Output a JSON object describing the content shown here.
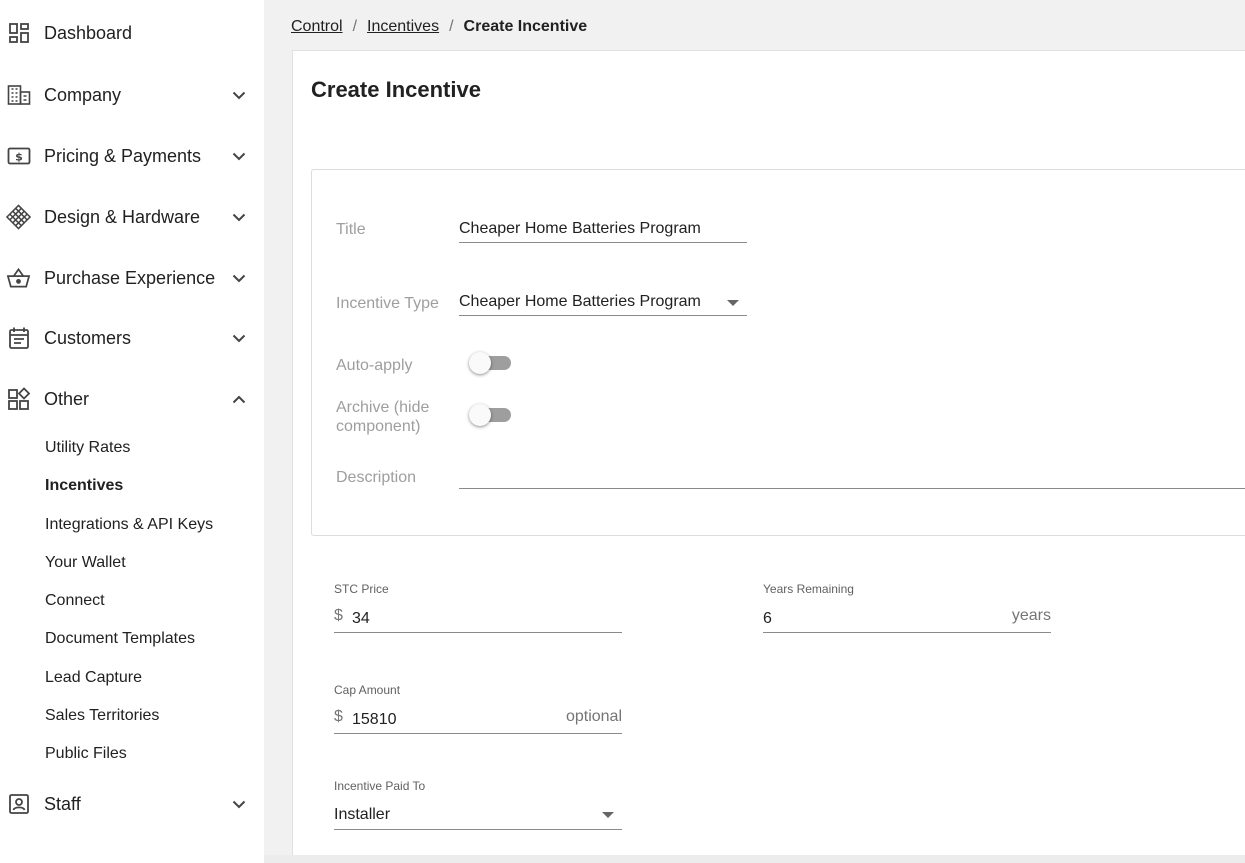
{
  "sidebar": {
    "items": [
      {
        "label": "Dashboard",
        "icon": "dashboard-icon"
      },
      {
        "label": "Company",
        "icon": "building-icon"
      },
      {
        "label": "Pricing & Payments",
        "icon": "dollar-bill-icon"
      },
      {
        "label": "Design & Hardware",
        "icon": "grid-diamond-icon"
      },
      {
        "label": "Purchase Experience",
        "icon": "basket-icon"
      },
      {
        "label": "Customers",
        "icon": "calendar-list-icon"
      },
      {
        "label": "Other",
        "icon": "widgets-icon"
      },
      {
        "label": "Staff",
        "icon": "badge-icon"
      }
    ],
    "other_sub": [
      {
        "label": "Utility Rates"
      },
      {
        "label": "Incentives",
        "active": true
      },
      {
        "label": "Integrations & API Keys"
      },
      {
        "label": "Your Wallet"
      },
      {
        "label": "Connect"
      },
      {
        "label": "Document Templates"
      },
      {
        "label": "Lead Capture"
      },
      {
        "label": "Sales Territories"
      },
      {
        "label": "Public Files"
      }
    ]
  },
  "breadcrumb": {
    "control": "Control",
    "incentives": "Incentives",
    "sep": "/",
    "current": "Create Incentive"
  },
  "page": {
    "title": "Create Incentive"
  },
  "form": {
    "title_label": "Title",
    "title_value": "Cheaper Home Batteries Program",
    "type_label": "Incentive Type",
    "type_value": "Cheaper Home Batteries Program",
    "auto_apply_label": "Auto-apply",
    "auto_apply_on": false,
    "archive_label_1": "Archive (hide",
    "archive_label_2": "component)",
    "archive_on": false,
    "description_label": "Description",
    "description_value": "",
    "stc_label": "STC Price",
    "stc_prefix": "$",
    "stc_value": "34",
    "years_label": "Years Remaining",
    "years_value": "6",
    "years_suffix": "years",
    "cap_label": "Cap Amount",
    "cap_prefix": "$",
    "cap_value": "15810",
    "cap_suffix": "optional",
    "paid_to_label": "Incentive Paid To",
    "paid_to_value": "Installer"
  },
  "colors": {
    "toggle_track_off": "#9e9e9e",
    "label_gray": "#9e9e9e"
  }
}
